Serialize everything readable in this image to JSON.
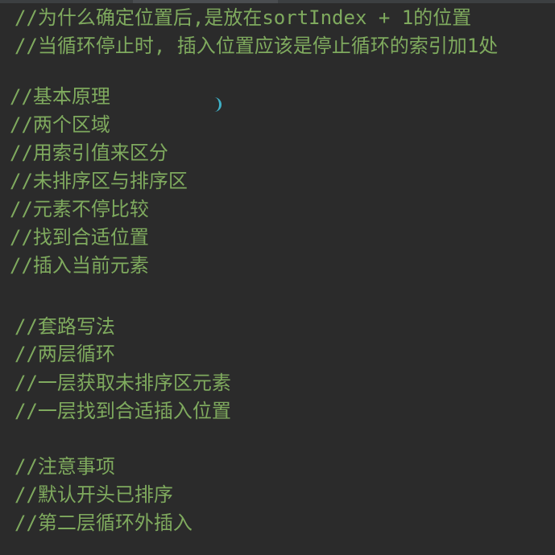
{
  "editor": {
    "lines": [
      "//为什么确定位置后,是放在sortIndex + 1的位置",
      "//当循环停止时, 插入位置应该是停止循环的索引加1处",
      "//基本原理",
      "//两个区域",
      "//用索引值来区分",
      "//未排序区与排序区",
      "//元素不停比较",
      "//找到合适位置",
      "//插入当前元素",
      "//套路写法",
      "//两层循环",
      "//一层获取未排序区元素",
      "//一层找到合适插入位置",
      "//注意事项",
      "//默认开头已排序",
      "//第二层循环外插入"
    ]
  },
  "colors": {
    "background": "#2b2b2b",
    "comment": "#7faa5e",
    "cursor": "#3fb0c6"
  }
}
